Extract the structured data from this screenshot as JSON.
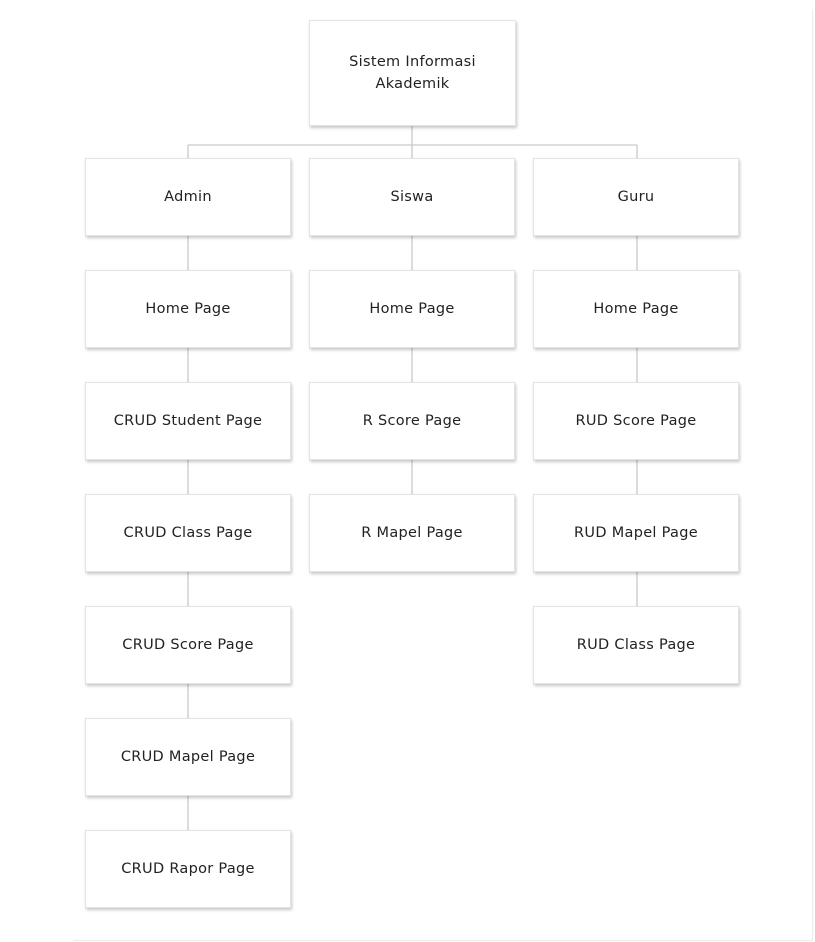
{
  "diagram": {
    "root": {
      "label": "Sistem Informasi\nAkademik"
    },
    "columns": [
      {
        "label": "Admin",
        "children": [
          "Home Page",
          "CRUD Student Page",
          "CRUD Class Page",
          "CRUD Score Page",
          "CRUD Mapel Page",
          "CRUD Rapor Page"
        ]
      },
      {
        "label": "Siswa",
        "children": [
          "Home Page",
          "R Score Page",
          "R Mapel Page"
        ]
      },
      {
        "label": "Guru",
        "children": [
          "Home Page",
          "RUD Score Page",
          "RUD Mapel Page",
          "RUD Class Page"
        ]
      }
    ]
  }
}
